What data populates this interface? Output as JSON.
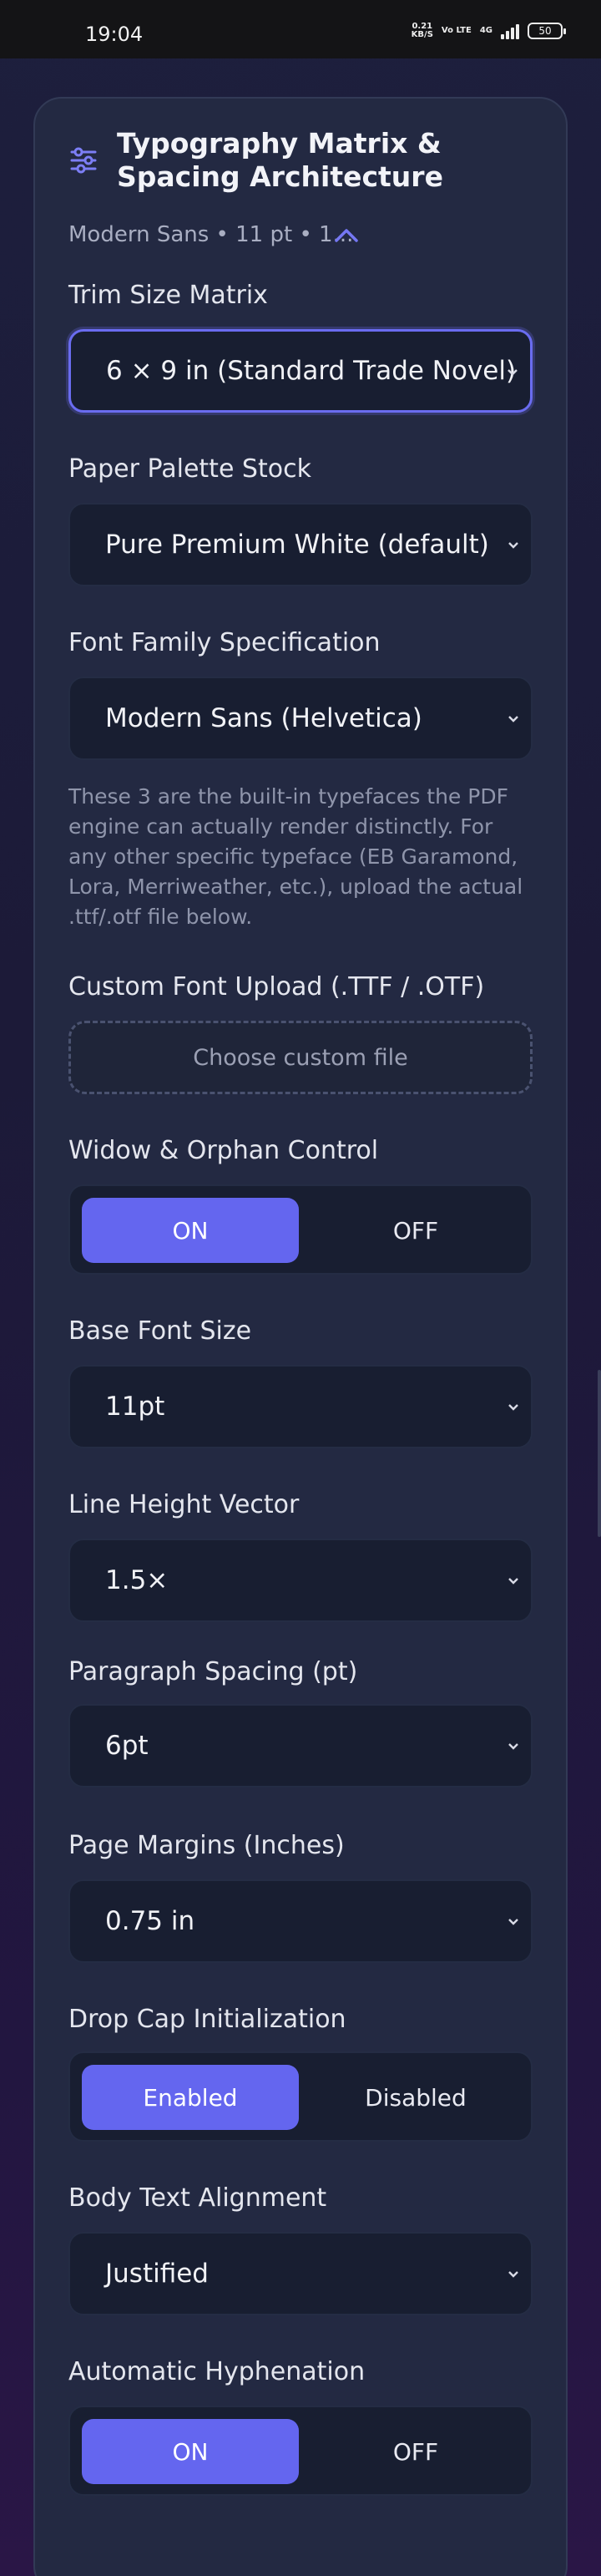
{
  "status_bar": {
    "time": "19:04",
    "net_speed_value": "0.21",
    "net_speed_unit": "KB/S",
    "volte": "Vo LTE",
    "network": "4G",
    "battery": "50"
  },
  "panel": {
    "title": "Typography Matrix & Spacing Architecture",
    "summary": "Modern Sans • 11 pt • 1...",
    "icon": "sliders-icon",
    "collapse_icon": "chevron-up-icon"
  },
  "fields": {
    "trim_size": {
      "label": "Trim Size Matrix",
      "value": "6 × 9 in (Standard Trade Novel)"
    },
    "paper_palette": {
      "label": "Paper Palette Stock",
      "value": "Pure Premium White (default)"
    },
    "font_family": {
      "label": "Font Family Specification",
      "value": "Modern Sans (Helvetica)",
      "help": "These 3 are the built-in typefaces the PDF engine can actually render distinctly. For any other specific typeface (EB Garamond, Lora, Merriweather, etc.), upload the actual .ttf/.otf file below."
    },
    "custom_font": {
      "label": "Custom Font Upload (.TTF / .OTF)",
      "button": "Choose custom file"
    },
    "widow_orphan": {
      "label": "Widow & Orphan Control",
      "on": "ON",
      "off": "OFF",
      "selected": "ON"
    },
    "base_font_size": {
      "label": "Base Font Size",
      "value": "11pt"
    },
    "line_height": {
      "label": "Line Height Vector",
      "value": "1.5×"
    },
    "paragraph_spacing": {
      "label": "Paragraph Spacing (pt)",
      "value": "6pt"
    },
    "page_margins": {
      "label": "Page Margins (Inches)",
      "value": "0.75 in"
    },
    "drop_cap": {
      "label": "Drop Cap Initialization",
      "on": "Enabled",
      "off": "Disabled",
      "selected": "Enabled"
    },
    "alignment": {
      "label": "Body Text Alignment",
      "value": "Justified"
    },
    "hyphenation": {
      "label": "Automatic Hyphenation",
      "on": "ON",
      "off": "OFF",
      "selected": "ON"
    }
  },
  "colors": {
    "accent": "#6466ef",
    "card": "#232942",
    "control": "#181e31"
  }
}
